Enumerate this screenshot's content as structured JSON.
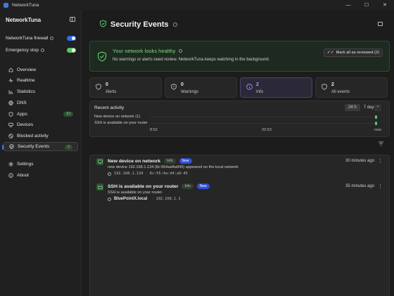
{
  "window": {
    "title": "NetworkTuna",
    "controls": [
      "—",
      "☐",
      "✕"
    ]
  },
  "sidebar": {
    "app_name": "NetworkTuna",
    "toggles": [
      {
        "label": "NetworkTuna firewall",
        "on": true,
        "color": "#2b6ff0"
      },
      {
        "label": "Emergency stop",
        "on": true,
        "color": "#5cc464"
      }
    ],
    "items": [
      {
        "label": "Overview",
        "icon": "home-icon"
      },
      {
        "label": "Realtime",
        "icon": "pulse-icon"
      },
      {
        "label": "Statistics",
        "icon": "chart-icon"
      },
      {
        "label": "DNS",
        "icon": "globe-icon"
      },
      {
        "label": "Apps",
        "icon": "shield-icon",
        "badge": "62"
      },
      {
        "label": "Devices",
        "icon": "devices-icon"
      },
      {
        "label": "Blocked activity",
        "icon": "blocked-icon"
      },
      {
        "label": "Security Events",
        "icon": "shield-check-icon",
        "badge": "2",
        "active": true
      }
    ],
    "bottom_items": [
      {
        "label": "Settings",
        "icon": "gear-icon"
      },
      {
        "label": "About",
        "icon": "info-icon"
      }
    ]
  },
  "main": {
    "title": "Security Events",
    "banner": {
      "title": "Your network looks healthy",
      "description": "No warnings or alerts need review. NetworkTuna keeps watching in the background.",
      "button": "Mark all as reviewed (2)"
    },
    "stats": [
      {
        "value": "0",
        "label": "Alerts"
      },
      {
        "value": "0",
        "label": "Warnings"
      },
      {
        "value": "2",
        "label": "Info"
      },
      {
        "value": "2",
        "label": "All events"
      }
    ],
    "activity": {
      "title": "Recent activity",
      "ranges": [
        "24 h",
        "7 days"
      ],
      "selected_range": "24 h",
      "rows": [
        {
          "label": "New device on network (1)",
          "position": 0.99
        },
        {
          "label": "SSH is available on your router",
          "position": 0.99
        }
      ],
      "ticks": [
        "8:53",
        "20:53",
        "now"
      ]
    },
    "events": [
      {
        "title": "New device on network",
        "tags": [
          "Info",
          "New"
        ],
        "time": "30 minutes ago",
        "description": "new device 192.168.1.134 (8c:554ad4a945) appeared on the local network",
        "meta": [
          "192.168.1.134",
          "8c:55:4a:d4:a9:45"
        ]
      },
      {
        "title": "SSH is available on your router",
        "tags": [
          "Info",
          "New"
        ],
        "time": "35 minutes ago",
        "description": "SSH is available on your router.",
        "host": "BluePointX.local",
        "meta": [
          "192.168.1.1"
        ]
      }
    ]
  }
}
